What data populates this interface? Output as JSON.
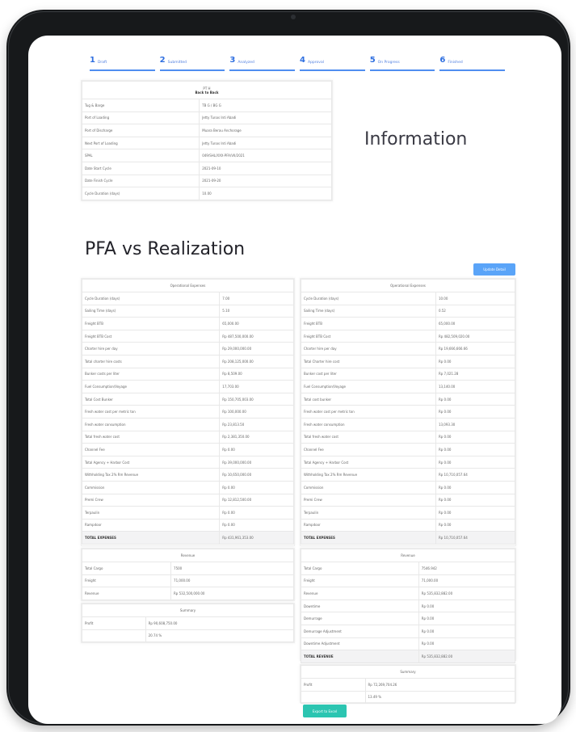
{
  "steps": [
    {
      "num": "1",
      "label": "Draft"
    },
    {
      "num": "2",
      "label": "Submitted"
    },
    {
      "num": "3",
      "label": "Analyzed"
    },
    {
      "num": "4",
      "label": "Approval"
    },
    {
      "num": "5",
      "label": "On Progress"
    },
    {
      "num": "6",
      "label": "Finished"
    }
  ],
  "info": {
    "title_line1": "PT H",
    "title_line2": "Back to Back",
    "rows": [
      [
        "Tug & Barge",
        "TB G / BG G"
      ],
      [
        "Port of Loading",
        "Jetty Tunas Inti Abadi"
      ],
      [
        "Port of Discharge",
        "Muara Berau Anchorage"
      ],
      [
        "Next Port of Loading",
        "Jetty Tunas Inti Abadi"
      ],
      [
        "SPAL",
        "049/SHL/XXX-PFA/VII/2021"
      ],
      [
        "Date Start Cycle",
        "2021-09-10"
      ],
      [
        "Date Finish Cycle",
        "2021-09-20"
      ],
      [
        "Cycle Duration (days)",
        "10.00"
      ]
    ],
    "heading": "Information"
  },
  "pfa_title": "PFA vs Realization",
  "update_button": "Update Detail",
  "export_button": "Export to Excel",
  "pfa": {
    "heading": "Operational Expenses",
    "rows": [
      [
        "Cycle Duration (days)",
        "7.00"
      ],
      [
        "Sailing Time (days)",
        "5.10"
      ],
      [
        "Freight BTB",
        "65,000.00"
      ],
      [
        "Freight BTB Cost",
        "Rp 487,500,000.00"
      ],
      [
        "Charter hire per day",
        "Rp 29,000,000.00"
      ],
      [
        "Total charter hire costs",
        "Rp 208,125,000.00"
      ],
      [
        "Bunker costs per liter",
        "Rp 8,509.00"
      ],
      [
        "Fuel Consumption/Voyage",
        "17,703.00"
      ],
      [
        "Total Cost Bunker",
        "Rp 150,705,003.00"
      ],
      [
        "Fresh water cost per metric ton",
        "Rp 100,000.00"
      ],
      [
        "Fresh water consumption",
        "Rp 23,813.50"
      ],
      [
        "Total fresh water cost",
        "Rp 2,381,350.00"
      ],
      [
        "Channel Fee",
        "Rp 0.00"
      ],
      [
        "Total Agency + Harbor Cost",
        "Rp 39,000,000.00"
      ],
      [
        "Withholding Tax 2% Rm Revenue",
        "Rp 10,650,000.00"
      ],
      [
        "Commission",
        "Rp 0.00"
      ],
      [
        "Premi Crew",
        "Rp 12,812,500.00"
      ],
      [
        "Terpaulin",
        "Rp 0.00"
      ],
      [
        "Rampdoor",
        "Rp 0.00"
      ],
      [
        "TOTAL EXPENSES",
        "Rp 431,961,353.00"
      ]
    ],
    "revenue_heading": "Revenue",
    "revenue": [
      [
        "Total Cargo",
        "7500"
      ],
      [
        "Freight",
        "71,000.00"
      ],
      [
        "Revenue",
        "Rp 532,500,000.00"
      ]
    ],
    "summary_heading": "Summary",
    "profit_label": "Profit",
    "profit_value": "Rp 90,608,750.00",
    "profit_pct": "20.74 %"
  },
  "real": {
    "heading": "Operational Expenses",
    "rows": [
      [
        "Cycle Duration (days)",
        "10.00"
      ],
      [
        "Sailing Time (days)",
        "0.52"
      ],
      [
        "Freight BTB",
        "65,000.00"
      ],
      [
        "Freight BTB Cost",
        "Rp 482,509,020.00"
      ],
      [
        "Charter hire per day",
        "Rp 19,666,666.66"
      ],
      [
        "Total Charter hire cost",
        "Rp 0.00"
      ],
      [
        "Bunker cost per liter",
        "Rp 7,021.28"
      ],
      [
        "Fuel Consumption/Voyage",
        "13,140.00"
      ],
      [
        "Total cost bunker",
        "Rp 0.00"
      ],
      [
        "Fresh water cost per metric ton",
        "Rp 0.00"
      ],
      [
        "Fresh water consumption",
        "13,093.30"
      ],
      [
        "Total fresh water cost",
        "Rp 0.00"
      ],
      [
        "Channel Fee",
        "Rp 0.00"
      ],
      [
        "Total Agency + Harbor Cost",
        "Rp 0.00"
      ],
      [
        "Withholding Tax 2% Rm Revenue",
        "Rp 10,710,057.64"
      ],
      [
        "Commission",
        "Rp 0.00"
      ],
      [
        "Premi Crew",
        "Rp 0.00"
      ],
      [
        "Terpaulin",
        "Rp 0.00"
      ],
      [
        "Rampdoor",
        "Rp 0.00"
      ],
      [
        "TOTAL EXPENSES",
        "Rp 10,710,057.64"
      ]
    ],
    "revenue_heading": "Revenue",
    "revenue": [
      [
        "Total Cargo",
        "7546.942"
      ],
      [
        "Freight",
        "71,000.00"
      ],
      [
        "Revenue",
        "Rp 535,832,882.00"
      ],
      [
        "Downtime",
        "Rp 0.00"
      ],
      [
        "Demurrage",
        "Rp 0.00"
      ],
      [
        "Demurrage Adjustment",
        "Rp 0.00"
      ],
      [
        "Downtime Adjustment",
        "Rp 0.00"
      ],
      [
        "TOTAL REVENUE",
        "Rp 535,832,882.00"
      ]
    ],
    "summary_heading": "Summary",
    "profit_label": "Profit",
    "profit_value": "Rp 72,269,704.26",
    "profit_pct": "13.49 %"
  }
}
